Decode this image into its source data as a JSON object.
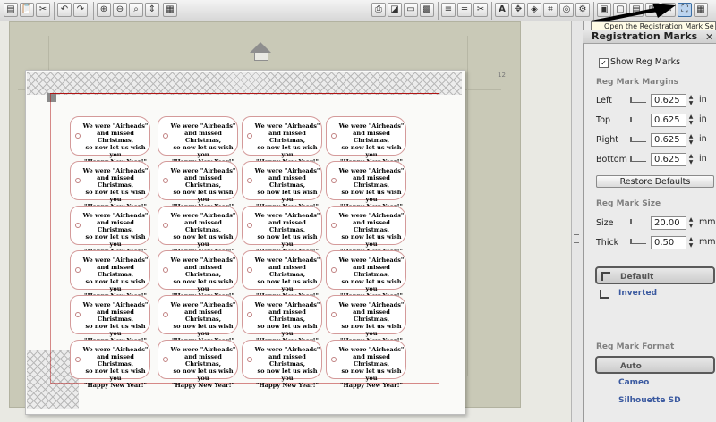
{
  "toolbar": {
    "icons": [
      "save-icon",
      "paste-icon",
      "cut-icon",
      "undo-icon",
      "redo-icon",
      "zoom-in-icon",
      "zoom-out-icon",
      "zoom-box-icon",
      "fit-page-icon",
      "grid-icon",
      "fill-icon",
      "line-color-icon",
      "line-style-icon",
      "knife-icon",
      "text-icon",
      "replicate-icon",
      "weld-icon",
      "scale-icon",
      "offset-icon",
      "trace-icon",
      "page-setup-icon",
      "design-page-icon",
      "cut-settings-icon",
      "reg-marks-icon"
    ]
  },
  "tooltip": {
    "text": "Open the Registration Mark Se"
  },
  "canvas": {
    "ruler_label": "12"
  },
  "tag_text": {
    "line1": "We were \"Airheads\"",
    "line2": "and missed Christmas,",
    "line3": "so now let us wish you",
    "line4": "\"Happy New Year!\""
  },
  "panel": {
    "title": "Registration Marks",
    "close": "✕",
    "show_reg_marks": {
      "label": "Show Reg Marks",
      "checked": true,
      "mark": "✓"
    },
    "margins_header": "Reg Mark Margins",
    "margins": [
      {
        "label": "Left",
        "value": "0.625",
        "unit": "in"
      },
      {
        "label": "Top",
        "value": "0.625",
        "unit": "in"
      },
      {
        "label": "Right",
        "value": "0.625",
        "unit": "in"
      },
      {
        "label": "Bottom",
        "value": "0.625",
        "unit": "in"
      }
    ],
    "restore_label": "Restore Defaults",
    "size_header": "Reg Mark Size",
    "size_fields": [
      {
        "label": "Size",
        "value": "20.00",
        "unit": "mm"
      },
      {
        "label": "Thick",
        "value": "0.50",
        "unit": "mm"
      }
    ],
    "style_options": [
      {
        "label": "Default",
        "selected": true
      },
      {
        "label": "Inverted",
        "selected": false
      }
    ],
    "format_header": "Reg Mark Format",
    "format_options": [
      {
        "label": "Auto",
        "selected": true
      },
      {
        "label": "Cameo",
        "selected": false
      },
      {
        "label": "Silhouette SD",
        "selected": false
      }
    ]
  },
  "colors": {
    "reg_line": "#b01515",
    "tag_border": "#d49a9a",
    "mat": "#c9c9b7"
  }
}
